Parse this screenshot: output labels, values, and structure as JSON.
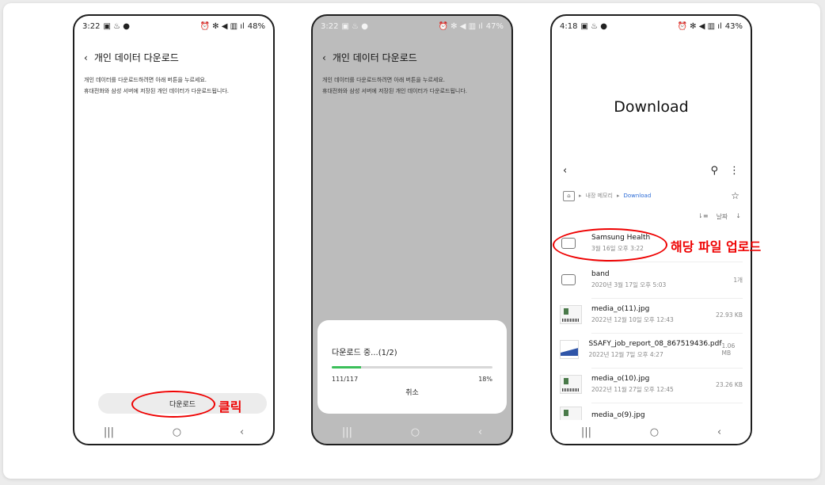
{
  "phone1": {
    "time": "3:22",
    "battery": "48%",
    "title": "개인 데이터 다운로드",
    "desc_line1": "개인 데이터를 다운로드하려면 아래 버튼을 누르세요.",
    "desc_line2": "휴대전화와 삼성 서버에 저장된 개인 데이터가 다운로드됩니다.",
    "download_button": "다운로드",
    "annotation": "클릭"
  },
  "phone2": {
    "time": "3:22",
    "battery": "47%",
    "title": "개인 데이터 다운로드",
    "desc_line1": "개인 데이터를 다운로드하려면 아래 버튼을 누르세요.",
    "desc_line2": "휴대전화와 삼성 서버에 저장된 개인 데이터가 다운로드됩니다.",
    "dialog_title": "다운로드 중...(1/2)",
    "progress_count": "111/117",
    "progress_percent": "18%",
    "progress_fraction": 0.18,
    "cancel_button": "취소"
  },
  "phone3": {
    "time": "4:18",
    "battery": "43%",
    "folder_title": "Download",
    "breadcrumb_parent": "내장 메모리",
    "breadcrumb_current": "Download",
    "sort_label": "날짜",
    "annotation": "해당 파일 업로드",
    "files": [
      {
        "name": "Samsung Health",
        "meta": "3월 16일 오후 3:22",
        "right": "",
        "kind": "folder"
      },
      {
        "name": "band",
        "meta": "2020년 3월 17일 오후 5:03",
        "right": "1개",
        "kind": "folder"
      },
      {
        "name": "media_o(11).jpg",
        "meta": "2022년 12월 10일 오후 12:43",
        "right": "22.93 KB",
        "kind": "image"
      },
      {
        "name": "SSAFY_job_report_08_867519436.pdf",
        "meta": "2022년 12월 7일 오후 4:27",
        "right": "1.06 MB",
        "kind": "pdf"
      },
      {
        "name": "media_o(10).jpg",
        "meta": "2022년 11월 27일 오후 12:45",
        "right": "23.26 KB",
        "kind": "image"
      },
      {
        "name": "media_o(9).jpg",
        "meta": "",
        "right": "",
        "kind": "image"
      }
    ]
  },
  "nav": {
    "recent": "|||",
    "home": "○",
    "back": "‹"
  },
  "colors": {
    "accent_red": "#e00000",
    "progress_green": "#3bbf5a",
    "link_blue": "#2b6bd6"
  }
}
